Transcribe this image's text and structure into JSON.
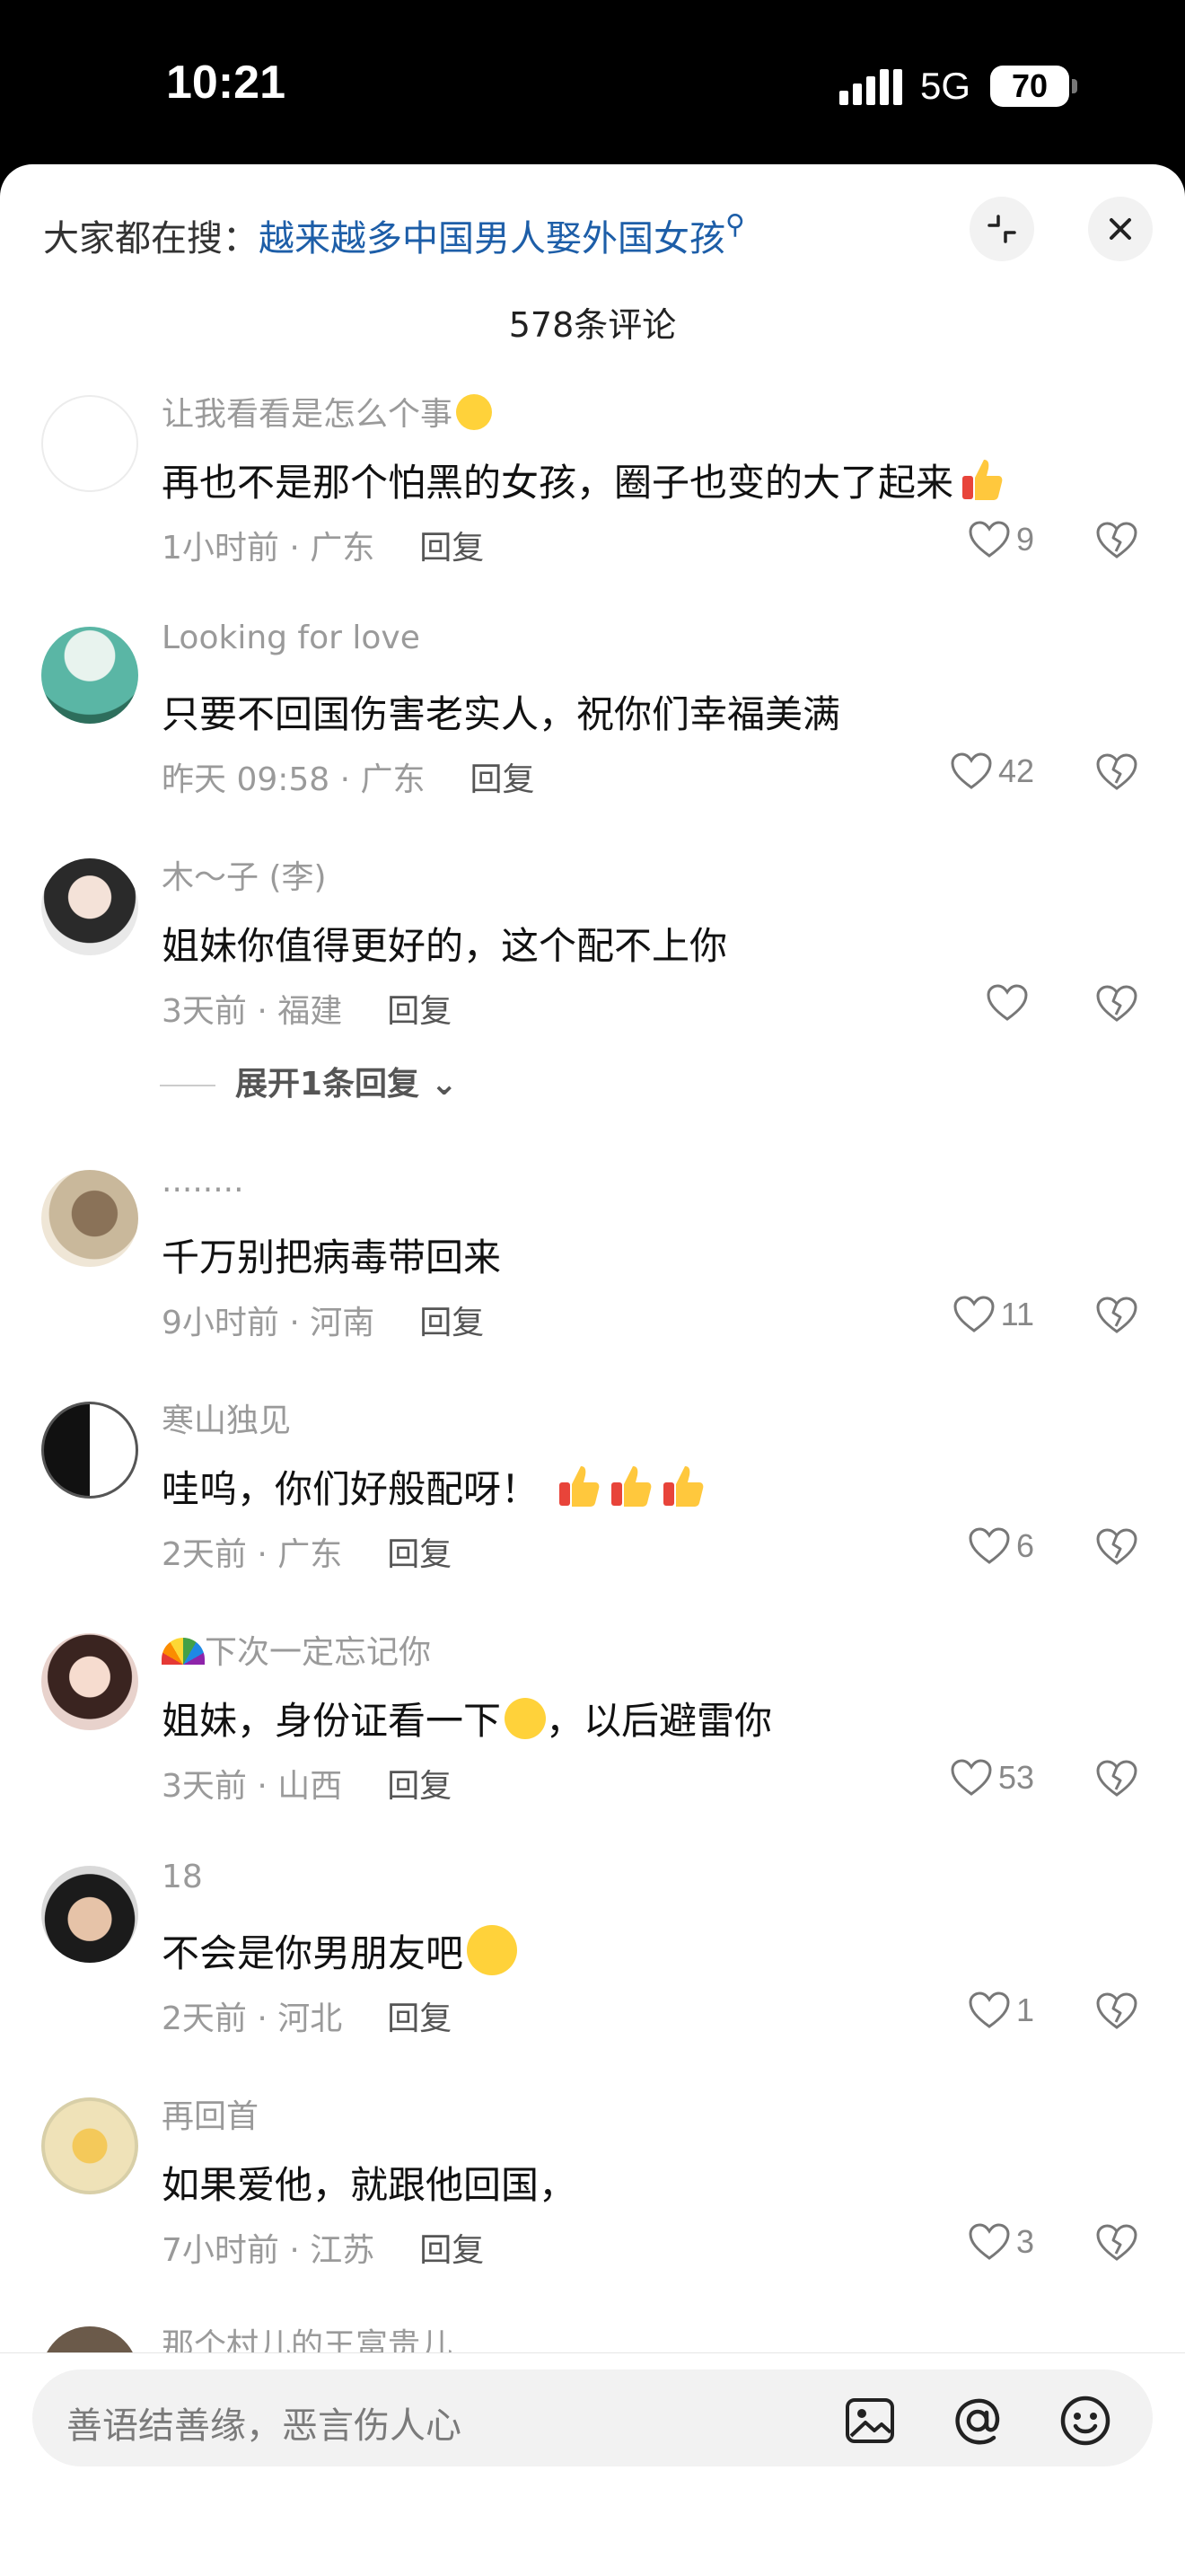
{
  "status_bar": {
    "time": "10:21",
    "network": "5G",
    "battery": "70"
  },
  "header": {
    "search_prefix": "大家都在搜：",
    "search_query": "越来越多中国男人娶外国女孩",
    "comment_count": "578条评论"
  },
  "comments": [
    {
      "user": "让我看看是怎么个事",
      "user_emoji": "thinking-face",
      "text": "再也不是那个怕黑的女孩，圈子也变的大了起来",
      "time": "1小时前 · 广东",
      "reply": "回复",
      "likes": "9"
    },
    {
      "user": "Looking for love",
      "text": "只要不回国伤害老实人，祝你们幸福美满",
      "time": "昨天 09:58 · 广东",
      "reply": "回复",
      "likes": "42"
    },
    {
      "user": "木～子 (李)",
      "text": "姐妹你值得更好的，这个配不上你",
      "time": "3天前 · 福建",
      "reply": "回复",
      "likes": "",
      "expand": "展开1条回复"
    },
    {
      "user": "........",
      "text": "千万别把病毒带回来",
      "time": "9小时前 · 河南",
      "reply": "回复",
      "likes": "11"
    },
    {
      "user": "寒山独见",
      "text": "哇呜，你们好般配呀！",
      "time": "2天前 · 广东",
      "reply": "回复",
      "likes": "6"
    },
    {
      "user": "下次一定忘记你",
      "text_a": "姐妹，身份证看一下",
      "text_b": "，以后避雷你",
      "time": "3天前 · 山西",
      "reply": "回复",
      "likes": "53"
    },
    {
      "user": "18",
      "text": "不会是你男朋友吧",
      "time": "2天前 · 河北",
      "reply": "回复",
      "likes": "1"
    },
    {
      "user": "再回首",
      "text": "如果爱他，就跟他回国，",
      "time": "7小时前 · 江苏",
      "reply": "回复",
      "likes": "3"
    }
  ],
  "partial_user": "那个村儿的王富贵儿",
  "input": {
    "placeholder": "善语结善缘，恶言伤人心"
  },
  "colors": {
    "link": "#1d5ea8",
    "muted": "#9a9a9a",
    "background": "#ffffff"
  }
}
